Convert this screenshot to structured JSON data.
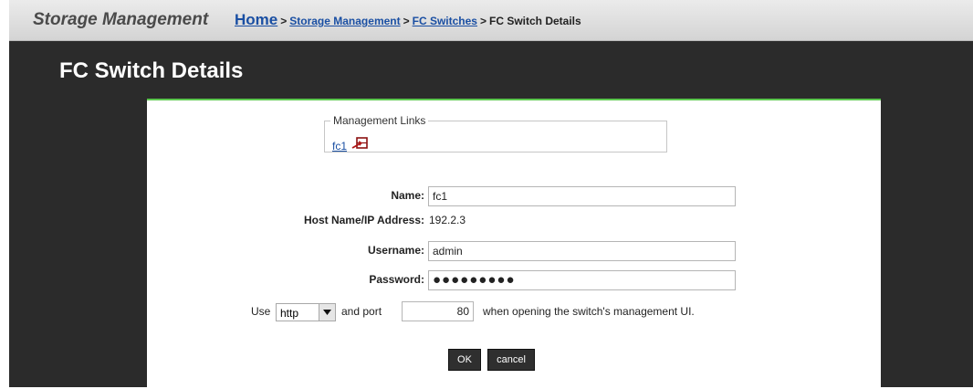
{
  "header": {
    "app_title": "Storage Management",
    "breadcrumb": {
      "home": "Home",
      "sep": ">",
      "storage_management": "Storage Management",
      "fc_switches": "FC Switches",
      "current": "FC Switch Details"
    }
  },
  "page_title": "FC Switch Details",
  "management_links": {
    "legend": "Management Links",
    "link_label": "fc1"
  },
  "form": {
    "name_label": "Name:",
    "name_value": "fc1",
    "host_label": "Host Name/IP Address:",
    "host_value": "192.2.3",
    "username_label": "Username:",
    "username_value": "admin",
    "password_label": "Password:",
    "password_value": "●●●●●●●●●"
  },
  "protocol_row": {
    "use_text": "Use",
    "protocol_value": "http",
    "and_port_text": "and port",
    "port_value": "80",
    "suffix_text": "when opening the switch's management UI."
  },
  "buttons": {
    "ok": "OK",
    "cancel": "cancel"
  },
  "colors": {
    "accent_green": "#5cc84f",
    "link_blue": "#1a4fa3",
    "background_dark": "#2b2b2b"
  }
}
